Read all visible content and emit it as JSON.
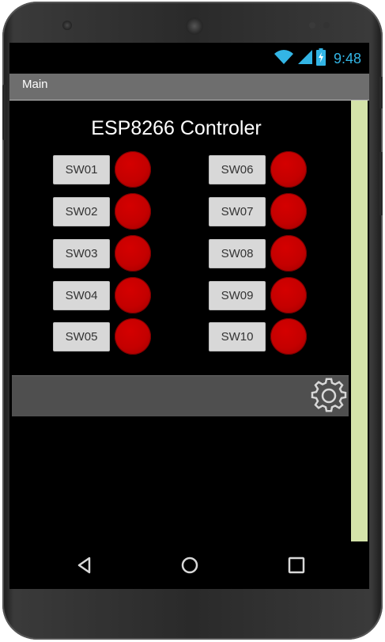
{
  "status": {
    "time": "9:48"
  },
  "titlebar": {
    "title": "Main"
  },
  "app": {
    "title": "ESP8266 Controler"
  },
  "switches": {
    "left": [
      {
        "label": "SW01",
        "state": "off"
      },
      {
        "label": "SW02",
        "state": "off"
      },
      {
        "label": "SW03",
        "state": "off"
      },
      {
        "label": "SW04",
        "state": "off"
      },
      {
        "label": "SW05",
        "state": "off"
      }
    ],
    "right": [
      {
        "label": "SW06",
        "state": "off"
      },
      {
        "label": "SW07",
        "state": "off"
      },
      {
        "label": "SW08",
        "state": "off"
      },
      {
        "label": "SW09",
        "state": "off"
      },
      {
        "label": "SW10",
        "state": "off"
      }
    ]
  },
  "colors": {
    "led_off": "#c40000",
    "title_bar": "#6e6e6e",
    "scrollbar": "#d4e3a9",
    "clock": "#33b5e5"
  },
  "icons": {
    "settings": "gear-icon",
    "back": "back-icon",
    "home": "home-icon",
    "recents": "recents-icon"
  }
}
